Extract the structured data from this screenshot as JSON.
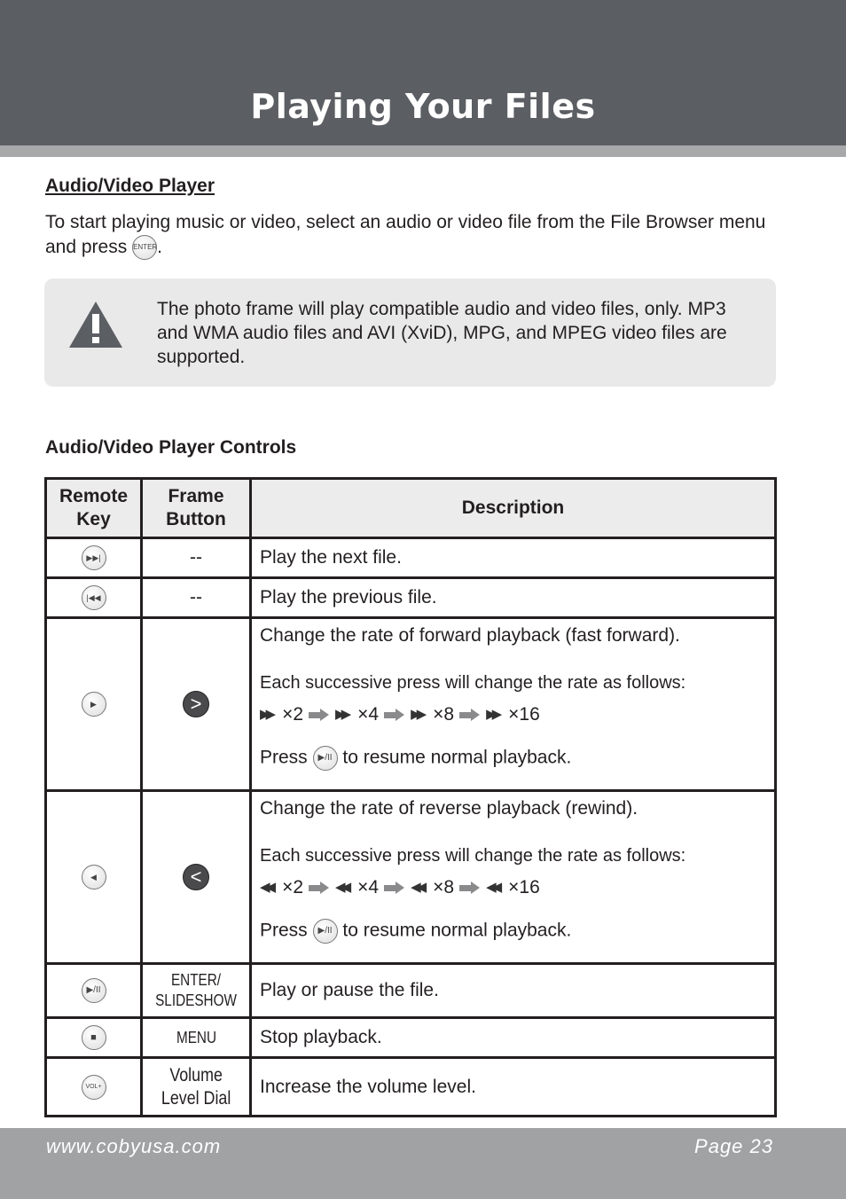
{
  "header": {
    "title": "Playing Your Files"
  },
  "section": {
    "title": "Audio/Video Player",
    "intro_a": "To start playing music or video, select an audio or video file from the File Browser menu and press ",
    "intro_b": ".",
    "enter_label": "ENTER"
  },
  "note": {
    "icon": "warning-icon",
    "text": "The photo frame will play compatible audio and video files, only. MP3 and WMA audio files and AVI (XviD), MPG, and MPEG video files are supported."
  },
  "controls": {
    "title": "Audio/Video Player Controls",
    "headers": [
      "Remote Key",
      "Frame Button",
      "Description"
    ],
    "rows": [
      {
        "remote_icon": "next-track-icon",
        "remote_glyph": "▶▶|",
        "frame": "--",
        "desc": "Play the next file."
      },
      {
        "remote_icon": "previous-track-icon",
        "remote_glyph": "|◀◀",
        "frame": "--",
        "desc": "Play the previous file."
      },
      {
        "remote_icon": "play-right-icon",
        "remote_glyph": "▶",
        "frame_icon": "chevron-right-icon",
        "frame_glyph": ">",
        "desc": "Change the rate of forward playback (fast forward).",
        "desc2": "Each successive press will change the rate as follows:",
        "rates": [
          "×2",
          "×4",
          "×8",
          "×16"
        ],
        "resume_a": "Press",
        "resume_b": "to resume normal playback."
      },
      {
        "remote_icon": "play-left-icon",
        "remote_glyph": "◀",
        "frame_icon": "chevron-left-icon",
        "frame_glyph": "<",
        "desc": "Change the rate of reverse playback (rewind).",
        "desc2": "Each successive press will change the rate as follows:",
        "rates": [
          "×2",
          "×4",
          "×8",
          "×16"
        ],
        "resume_a": "Press",
        "resume_b": "to resume normal playback."
      },
      {
        "remote_icon": "play-pause-icon",
        "remote_glyph": "▶/II",
        "frame_a": "ENTER/",
        "frame_b": "SLIDESHOW",
        "desc": "Play or pause the file."
      },
      {
        "remote_icon": "stop-icon",
        "remote_glyph": "■",
        "frame": "MENU",
        "desc": "Stop playback."
      },
      {
        "remote_icon": "volume-up-icon",
        "remote_glyph": "VOL+",
        "frame_a": "Volume",
        "frame_b": "Level Dial",
        "desc": "Increase the volume level."
      }
    ],
    "play_pause_glyph": "▶/II"
  },
  "footer": {
    "url": "www.cobyusa.com",
    "page": "Page 23"
  }
}
